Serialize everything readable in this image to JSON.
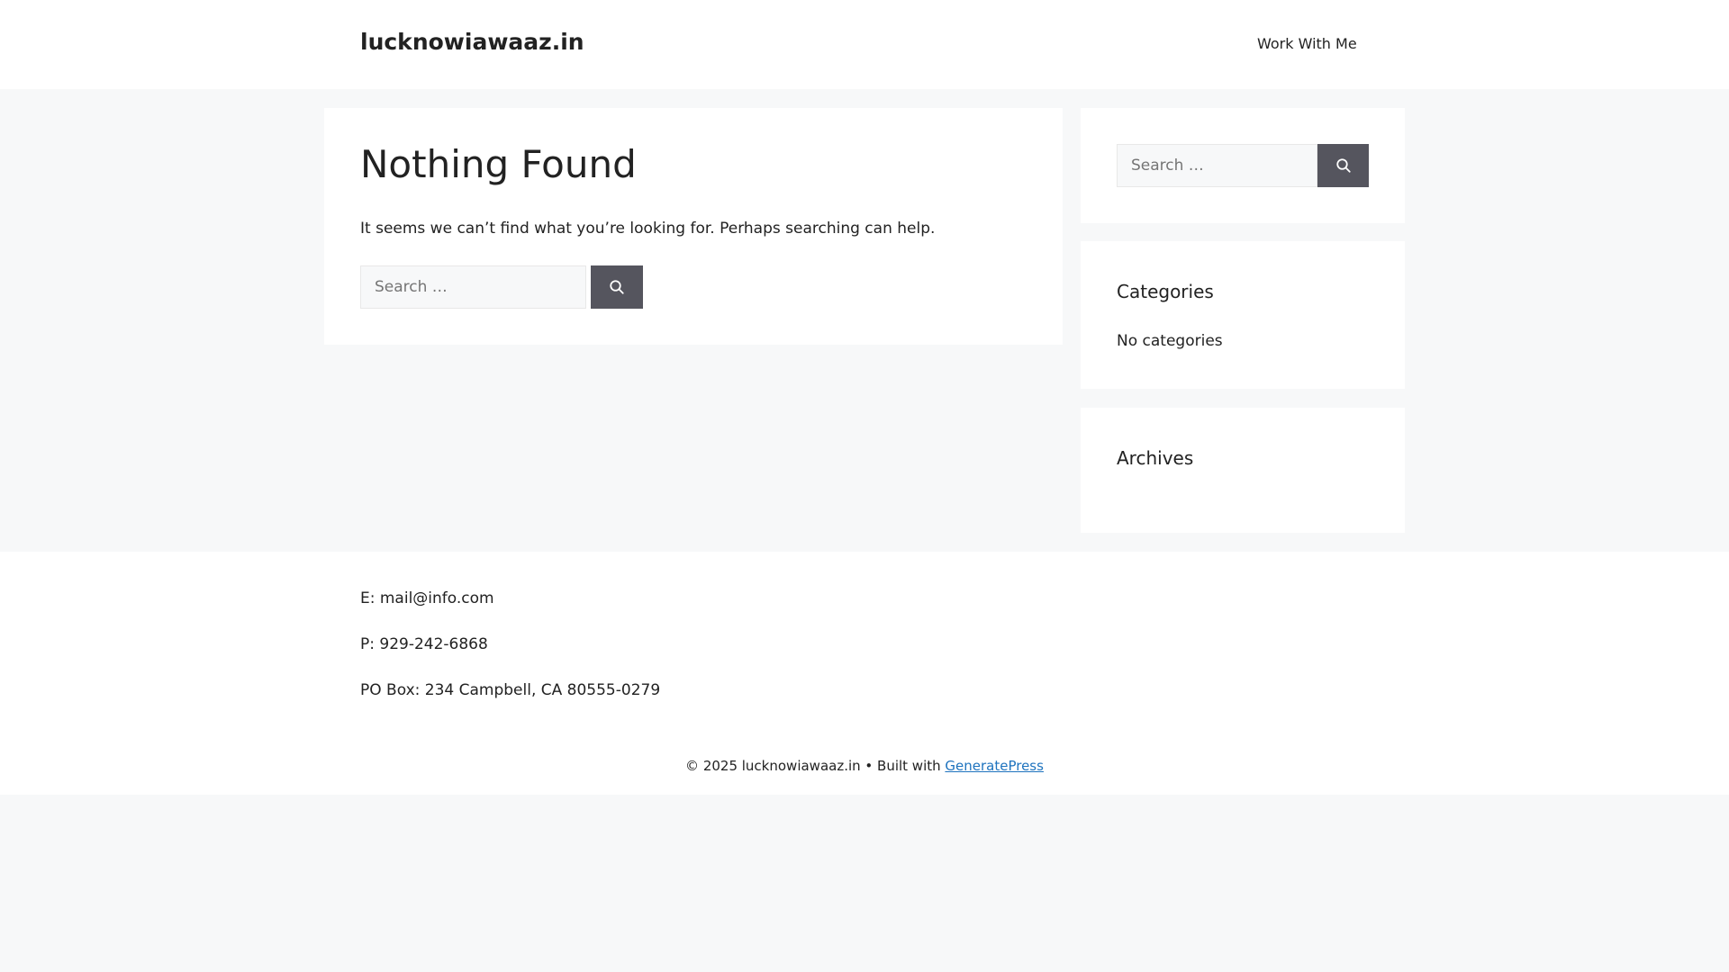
{
  "header": {
    "site_title": "lucknowiawaaz.in",
    "nav": [
      {
        "label": "Work With Me"
      }
    ]
  },
  "main": {
    "title": "Nothing Found",
    "message": "It seems we can’t find what you’re looking for. Perhaps searching can help.",
    "search": {
      "placeholder": "Search …",
      "value": "",
      "button_icon": "search-icon"
    }
  },
  "sidebar": {
    "search": {
      "placeholder": "Search …",
      "value": "",
      "button_icon": "search-icon"
    },
    "categories": {
      "title": "Categories",
      "empty_text": "No categories"
    },
    "archives": {
      "title": "Archives"
    }
  },
  "footer": {
    "email": "E: mail@info.com",
    "phone": "P: 929-242-6868",
    "address": "PO Box: 234 Campbell, CA 80555-0279",
    "copyright_prefix": "© 2025 lucknowiawaaz.in • Built with ",
    "credit_link": "GeneratePress"
  },
  "colors": {
    "page_bg": "#f7f8f9",
    "card_bg": "#ffffff",
    "button_bg": "#55555e",
    "link": "#1e73be",
    "text": "#222222"
  }
}
